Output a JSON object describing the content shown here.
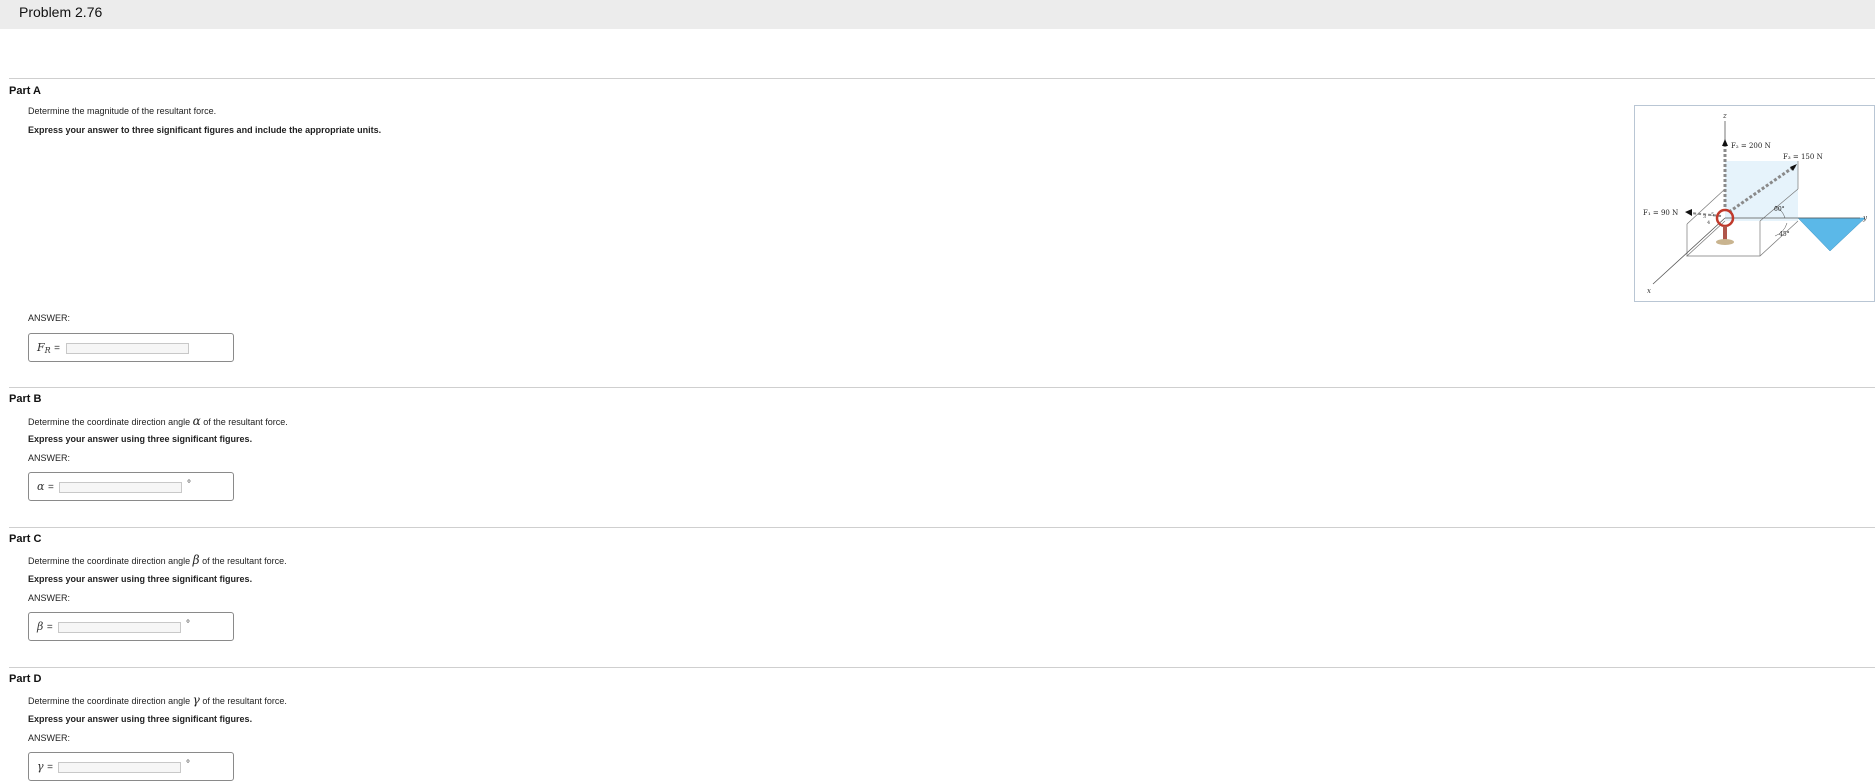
{
  "header": {
    "title": "Problem 2.76"
  },
  "parts": [
    {
      "heading": "Part A",
      "question": "Determine the magnitude of the resultant force.",
      "instruction": "Express your answer to three significant figures and include the appropriate units.",
      "answer_label": "ANSWER:",
      "variable": "F",
      "variable_sub": "R",
      "equals": "=",
      "input_value": ""
    },
    {
      "heading": "Part B",
      "question_pre": "Determine the coordinate direction angle",
      "question_symbol": "α",
      "question_post": "of the resultant force.",
      "instruction": "Express your answer using three significant figures.",
      "answer_label": "ANSWER:",
      "variable": "α",
      "equals": "=",
      "input_value": "",
      "unit": "°"
    },
    {
      "heading": "Part C",
      "question_pre": "Determine the coordinate direction angle",
      "question_symbol": "β",
      "question_post": "of the resultant force.",
      "instruction": "Express your answer using three significant figures.",
      "answer_label": "ANSWER:",
      "variable": "β",
      "equals": "=",
      "input_value": "",
      "unit": "°"
    },
    {
      "heading": "Part D",
      "question_pre": "Determine the coordinate direction angle",
      "question_symbol": "γ",
      "question_post": "of the resultant force.",
      "instruction": "Express your answer using three significant figures.",
      "answer_label": "ANSWER:",
      "variable": "γ",
      "equals": "=",
      "input_value": "",
      "unit": "°"
    }
  ],
  "figure": {
    "axis_z": "z",
    "axis_y": "y",
    "axis_x": "x",
    "f1_label": "F₁ = 90 N",
    "f2_label": "F₂ = 200 N",
    "f3_label": "F₃ = 150 N",
    "angle_60": "60°",
    "angle_45": "45°",
    "small_3": "3",
    "small_4": "4",
    "small_5": "5",
    "colors": {
      "plane": "#dff0fb",
      "wedge": "#5bb8e8",
      "ring": "#c0392b",
      "chain": "#8a8a8a"
    }
  }
}
